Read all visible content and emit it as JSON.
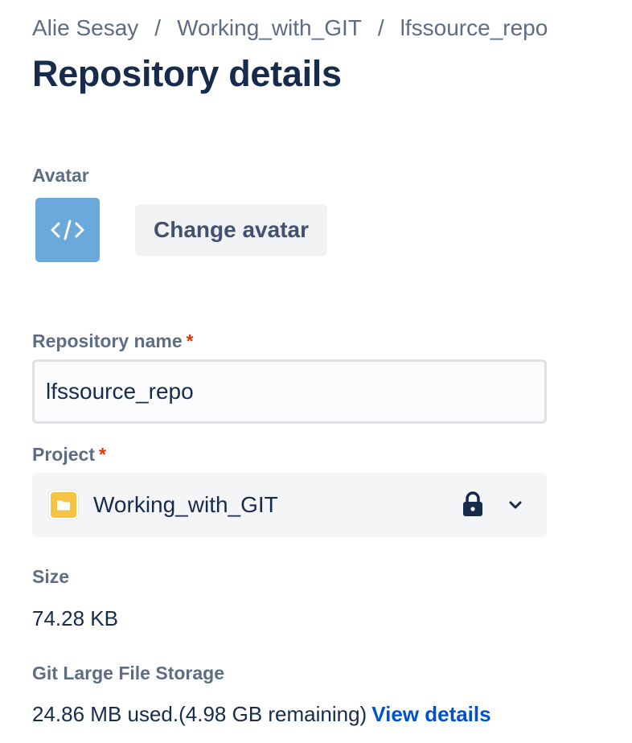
{
  "breadcrumb": {
    "items": [
      "Alie Sesay",
      "Working_with_GIT",
      "lfssource_repo"
    ],
    "separator": "/"
  },
  "page_title": "Repository details",
  "avatar_section": {
    "label": "Avatar",
    "icon": "code-icon",
    "avatar_color": "#6aa9dc",
    "change_button_label": "Change avatar"
  },
  "repository_name": {
    "label": "Repository name",
    "required_marker": "*",
    "value": "lfssource_repo"
  },
  "project": {
    "label": "Project",
    "required_marker": "*",
    "selected_value": "Working_with_GIT",
    "icon": "folder-icon",
    "folder_color": "#f6c342",
    "lock_icon": "lock-icon",
    "dropdown_icon": "chevron-down-icon"
  },
  "size": {
    "label": "Size",
    "value": "74.28 KB"
  },
  "lfs": {
    "label": "Git Large File Storage",
    "usage_text": "24.86 MB used.(4.98 GB remaining)",
    "link_label": "View details"
  },
  "colors": {
    "heading": "#172b4d",
    "label": "#5e6c84",
    "required": "#de350b",
    "link": "#0052cc"
  }
}
